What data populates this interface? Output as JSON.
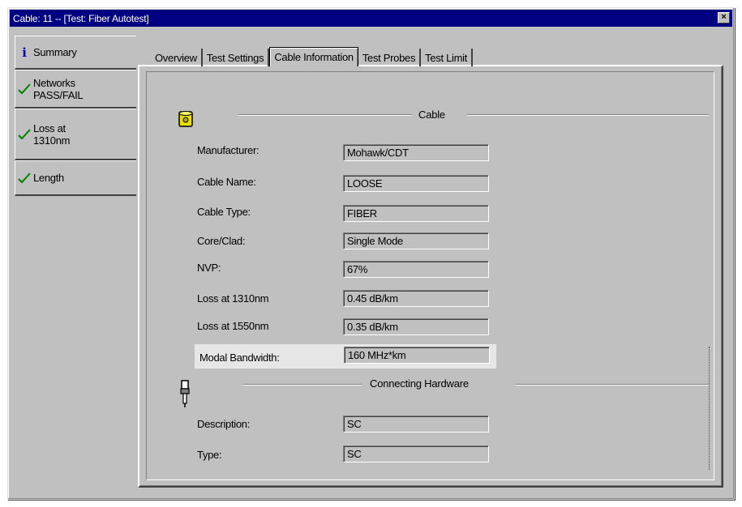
{
  "window": {
    "title": "Cable: 11 -- [Test: Fiber Autotest]",
    "close_glyph": "×"
  },
  "side_tabs": [
    {
      "label": "Summary",
      "icon": "info-icon",
      "lines": [
        "Summary"
      ]
    },
    {
      "label": "Networks PASS/FAIL",
      "icon": "check-icon",
      "lines": [
        "Networks",
        "PASS/FAIL"
      ]
    },
    {
      "label": "Loss at 1310nm",
      "icon": "check-icon",
      "lines": [
        "Loss at",
        "1310nm"
      ]
    },
    {
      "label": "Length",
      "icon": "check-icon",
      "lines": [
        "Length"
      ]
    }
  ],
  "tabs": [
    {
      "label": "Overview"
    },
    {
      "label": "Test Settings"
    },
    {
      "label": "Cable Information",
      "active": true
    },
    {
      "label": "Test Probes"
    },
    {
      "label": "Test Limit"
    }
  ],
  "cable_section": {
    "title": "Cable",
    "icon": "cable-spool-icon",
    "fields": [
      {
        "label": "Manufacturer:",
        "value": "Mohawk/CDT"
      },
      {
        "label": "Cable Name:",
        "value": "LOOSE"
      },
      {
        "label": "Cable Type:",
        "value": "FIBER"
      },
      {
        "label": "Core/Clad:",
        "value": "Single Mode"
      },
      {
        "label": "NVP:",
        "value": "67%"
      },
      {
        "label": "Loss at 1310nm",
        "value": "0.45 dB/km"
      },
      {
        "label": "Loss at 1550nm",
        "value": "0.35 dB/km"
      },
      {
        "label": "Modal Bandwidth:",
        "value": "160 MHz*km"
      }
    ]
  },
  "hardware_section": {
    "title": "Connecting Hardware",
    "icon": "connector-icon",
    "fields": [
      {
        "label": "Description:",
        "value": "SC"
      },
      {
        "label": "Type:",
        "value": "SC"
      }
    ]
  },
  "colors": {
    "title_bar": "#000080",
    "face": "#c0c0c0",
    "check": "#008000",
    "info": "#0000c0"
  }
}
